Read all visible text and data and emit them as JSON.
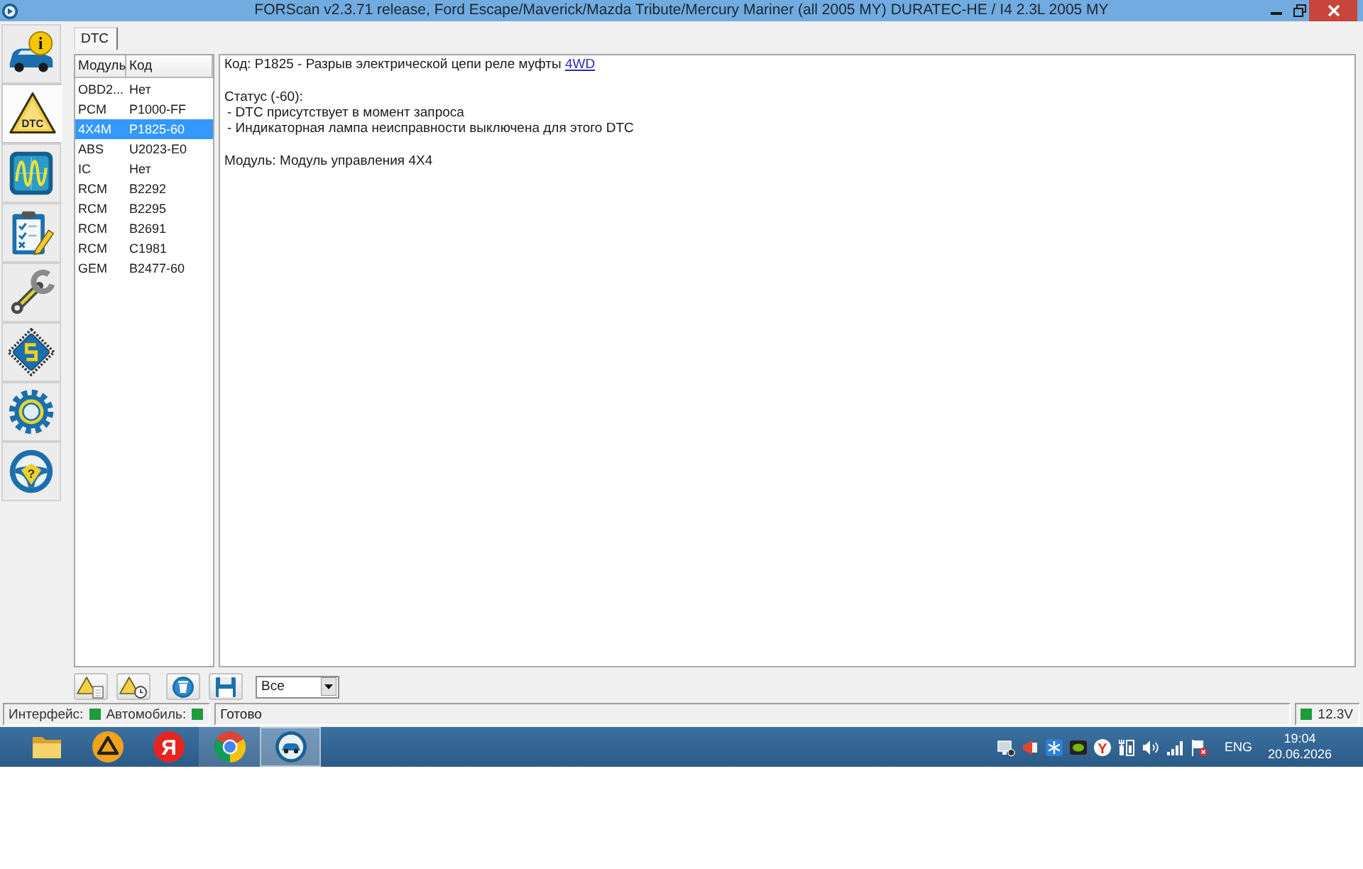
{
  "window": {
    "title": "FORScan v2.3.71 release, Ford Escape/Maverick/Mazda Tribute/Mercury Mariner (all 2005 MY) DURATEC-HE / I4 2.3L 2005 MY"
  },
  "sidebar": {
    "items": [
      {
        "kind": "vehicle",
        "badge": "i",
        "selected": false
      },
      {
        "kind": "dtc",
        "badge": "DTC",
        "selected": true
      },
      {
        "kind": "oscilloscope",
        "selected": false
      },
      {
        "kind": "checklist",
        "selected": false
      },
      {
        "kind": "wrench",
        "selected": false
      },
      {
        "kind": "chip",
        "selected": false
      },
      {
        "kind": "gear",
        "selected": false
      },
      {
        "kind": "help",
        "badge": "?",
        "selected": false
      }
    ]
  },
  "tabs": [
    {
      "label": "DTC",
      "selected": true
    }
  ],
  "dtc_table": {
    "columns": [
      "Модуль",
      "Код"
    ],
    "rows": [
      {
        "module": "OBD2...",
        "code": "Нет",
        "selected": false
      },
      {
        "module": "PCM",
        "code": "P1000-FF",
        "selected": false
      },
      {
        "module": "4X4M",
        "code": "P1825-60",
        "selected": true
      },
      {
        "module": "ABS",
        "code": "U2023-E0",
        "selected": false
      },
      {
        "module": "IC",
        "code": "Нет",
        "selected": false
      },
      {
        "module": "RCM",
        "code": "B2292",
        "selected": false
      },
      {
        "module": "RCM",
        "code": "B2295",
        "selected": false
      },
      {
        "module": "RCM",
        "code": "B2691",
        "selected": false
      },
      {
        "module": "RCM",
        "code": "C1981",
        "selected": false
      },
      {
        "module": "GEM",
        "code": "B2477-60",
        "selected": false
      }
    ]
  },
  "details": {
    "code_text": "Код: P1825 - Разрыв электрической цепи реле муфты",
    "code_link": "4WD",
    "status_title": "Статус (-60):",
    "status_items": [
      "- DTC присутствует в момент запроса",
      "- Индикаторная лампа неисправности выключена для этого DTC"
    ],
    "module_text": "Модуль: Модуль управления 4X4"
  },
  "toolbar": {
    "buttons": [
      {
        "kind": "warning-document"
      },
      {
        "kind": "warning-circle"
      },
      {
        "kind": "clear"
      },
      {
        "kind": "save"
      }
    ],
    "filter": {
      "value": "Все"
    }
  },
  "status_bar": {
    "indicators": [
      {
        "label": "Интерфейс:",
        "color": "#1e9b3c"
      },
      {
        "label": "Автомобиль:",
        "color": "#1e9b3c"
      }
    ],
    "message": "Готово",
    "voltage": {
      "text": "12.3V",
      "color": "#1e9b3c"
    }
  },
  "taskbar": {
    "apps": [
      {
        "kind": "folder",
        "open": false,
        "selected": false
      },
      {
        "kind": "triangle",
        "open": false,
        "selected": false
      },
      {
        "kind": "letter",
        "label": "Я",
        "open": false,
        "selected": false
      },
      {
        "kind": "ring",
        "open": true,
        "selected": false
      },
      {
        "kind": "car",
        "open": true,
        "selected": true
      }
    ],
    "tray": [
      {
        "kind": "computer"
      },
      {
        "kind": "megaphone"
      },
      {
        "kind": "snowflake"
      },
      {
        "kind": "card"
      },
      {
        "kind": "letter",
        "label": "Y"
      },
      {
        "kind": "device"
      },
      {
        "kind": "volume"
      },
      {
        "kind": "signal"
      },
      {
        "kind": "flag-x"
      }
    ],
    "language": "ENG",
    "time": "19:04",
    "date": "20.06.2026"
  }
}
